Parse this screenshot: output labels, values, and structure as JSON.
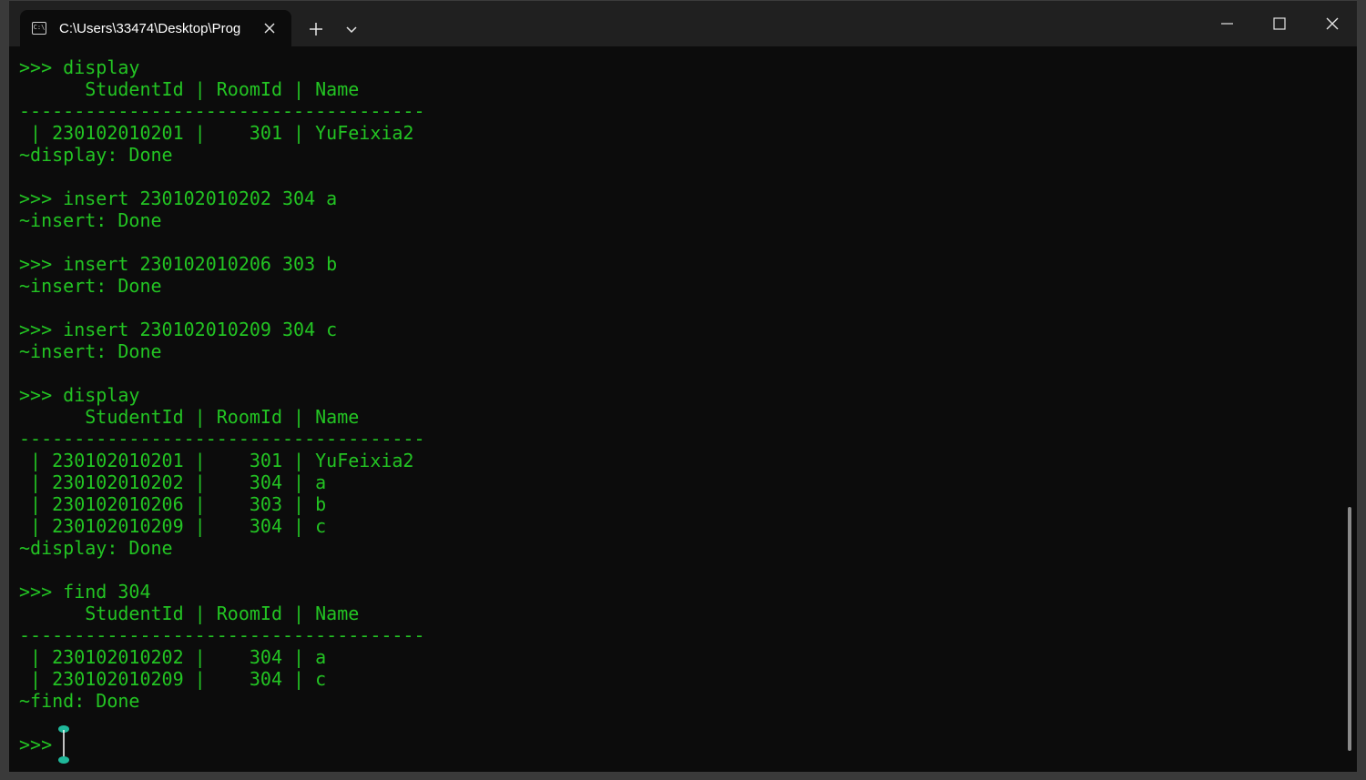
{
  "window": {
    "tab_title": "C:\\Users\\33474\\Desktop\\Prog",
    "tab_icon": "C:\\",
    "icons": {
      "tab": "terminal-icon",
      "tab_close": "close-icon",
      "new_tab": "plus-icon",
      "dropdown": "chevron-down-icon",
      "minimize": "minimize-icon",
      "maximize": "maximize-icon",
      "close": "close-icon"
    }
  },
  "terminal": {
    "text_color": "#23c423",
    "lines": [
      ">>> display",
      "      StudentId | RoomId | Name",
      "-------------------------------------",
      " | 230102010201 |    301 | YuFeixia2",
      "~display: Done",
      "",
      ">>> insert 230102010202 304 a",
      "~insert: Done",
      "",
      ">>> insert 230102010206 303 b",
      "~insert: Done",
      "",
      ">>> insert 230102010209 304 c",
      "~insert: Done",
      "",
      ">>> display",
      "      StudentId | RoomId | Name",
      "-------------------------------------",
      " | 230102010201 |    301 | YuFeixia2",
      " | 230102010202 |    304 | a",
      " | 230102010206 |    303 | b",
      " | 230102010209 |    304 | c",
      "~display: Done",
      "",
      ">>> find 304",
      "      StudentId | RoomId | Name",
      "-------------------------------------",
      " | 230102010202 |    304 | a",
      " | 230102010209 |    304 | c",
      "~find: Done",
      "",
      ">>> "
    ]
  }
}
